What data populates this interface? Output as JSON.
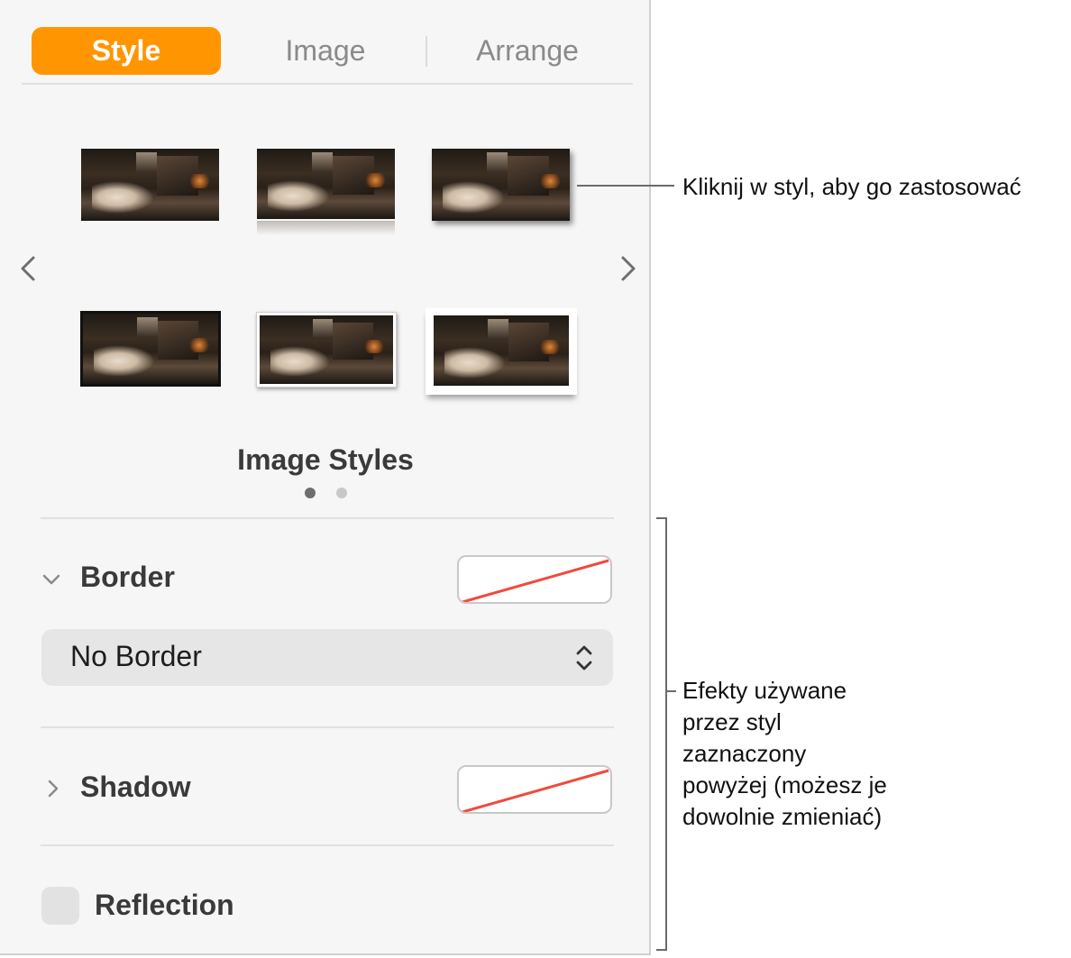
{
  "tabs": {
    "style": "Style",
    "image": "Image",
    "arrange": "Arrange"
  },
  "styles_gallery": {
    "title": "Image Styles",
    "page_count": 2,
    "current_page": 1
  },
  "border": {
    "label": "Border",
    "dropdown_value": "No Border"
  },
  "shadow": {
    "label": "Shadow"
  },
  "reflection": {
    "label": "Reflection",
    "checked": false
  },
  "callouts": {
    "apply_style": "Kliknij w styl, aby go zastosować",
    "effects_line1": "Efekty używane",
    "effects_line2": "przez styl",
    "effects_line3": "zaznaczony",
    "effects_line4": "powyżej (możesz je",
    "effects_line5": "dowolnie zmieniać)"
  },
  "colors": {
    "accent": "#ff9500",
    "no_fill_slash": "#f04a3e"
  }
}
